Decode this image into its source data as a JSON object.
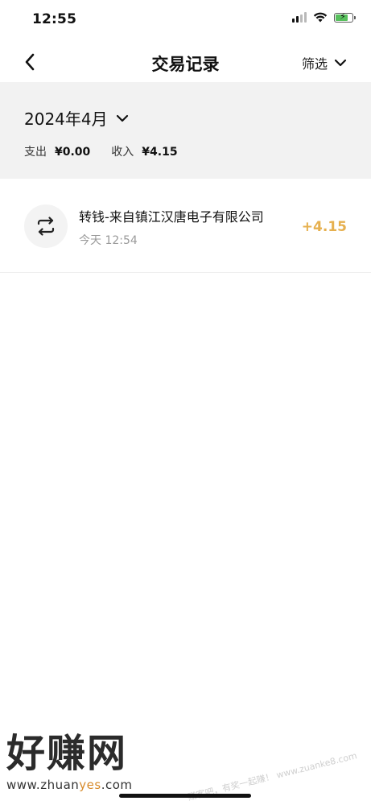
{
  "status_bar": {
    "time": "12:55",
    "icons": [
      "signal-icon",
      "wifi-icon",
      "battery-charging-icon"
    ]
  },
  "nav": {
    "title": "交易记录",
    "filter_label": "筛选",
    "back_icon": "chevron-left-icon",
    "filter_icon": "chevron-down-icon"
  },
  "summary": {
    "month": "2024年4月",
    "month_icon": "chevron-down-icon",
    "expense_label": "支出",
    "expense_amount": "¥0.00",
    "income_label": "收入",
    "income_amount": "¥4.15"
  },
  "transactions": [
    {
      "icon": "transfer-icon",
      "title": "转钱-来自镇江汉唐电子有限公司",
      "time": "今天 12:54",
      "amount": "+4.15"
    }
  ],
  "watermark": {
    "brand": "好赚网",
    "url_prefix": "www.zhuan",
    "url_accent": "yes",
    "url_suffix": ".com",
    "side_text": "赚客吧，有奖一起赚！ www.zuanke8.com"
  },
  "colors": {
    "income_amount": "#e6b04f",
    "summary_bg": "#f2f2f2",
    "battery_fill": "#57c05d",
    "watermark_accent": "#d78a2a"
  }
}
